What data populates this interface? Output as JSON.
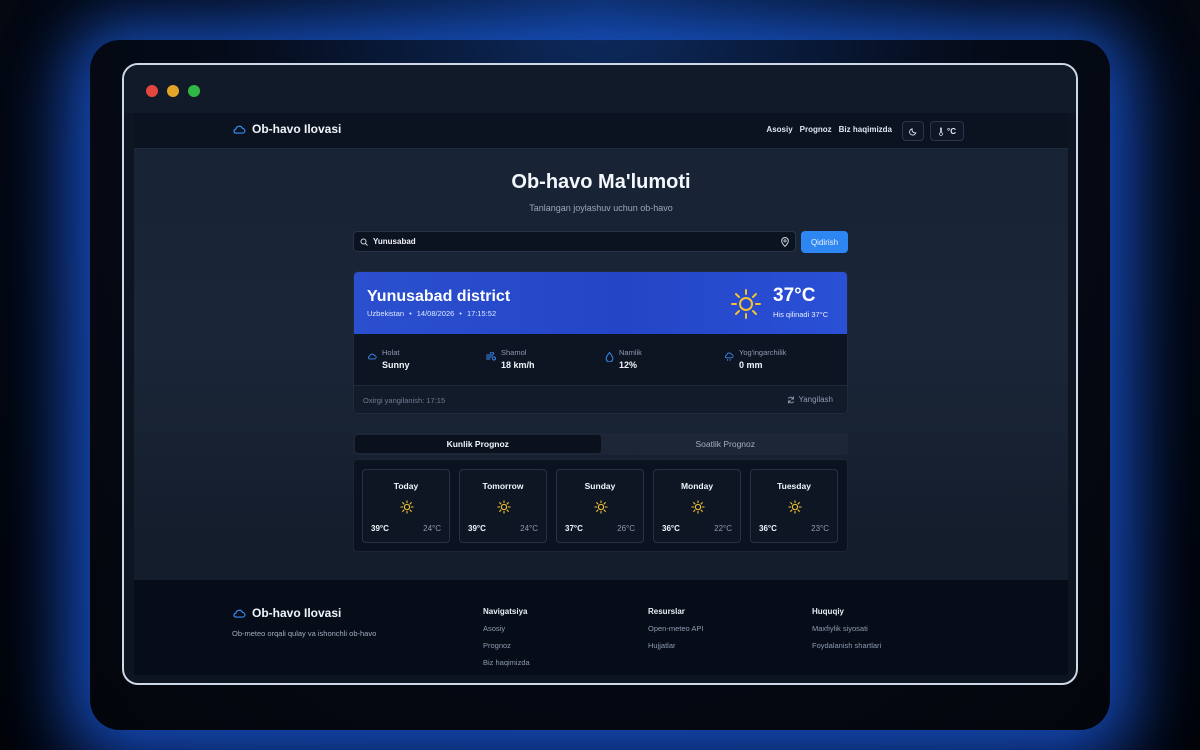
{
  "colors": {
    "accent": "#2e86f2",
    "header_gradient_start": "#2a4fcf",
    "sun": "#f2c230",
    "background": "#172235"
  },
  "navbar": {
    "brand": "Ob-havo Ilovasi",
    "links": [
      "Asosiy",
      "Prognoz",
      "Biz haqimizda"
    ],
    "theme_icon": "moon-icon",
    "unit_label": "°C"
  },
  "hero": {
    "title": "Ob-havo Ma'lumoti",
    "subtitle": "Tanlangan joylashuv uchun ob-havo"
  },
  "search": {
    "value": "Yunusabad",
    "button": "Qidirish"
  },
  "current": {
    "location": "Yunusabad district",
    "country": "Uzbekistan",
    "date": "14/08/2026",
    "time": "17:15:52",
    "temperature": "37°C",
    "feels_like": "His qilinadi 37°C",
    "stats": [
      {
        "label": "Holat",
        "value": "Sunny",
        "icon": "cloud-icon"
      },
      {
        "label": "Shamol",
        "value": "18 km/h",
        "icon": "wind-icon"
      },
      {
        "label": "Namlik",
        "value": "12%",
        "icon": "humidity-icon"
      },
      {
        "label": "Yog'ingarchilik",
        "value": "0 mm",
        "icon": "rain-icon"
      }
    ],
    "updated": "Oxirgi yangilanish: 17:15",
    "refresh": "Yangilash"
  },
  "tabs": [
    "Kunlik Prognoz",
    "Soatlik Prognoz"
  ],
  "forecast": [
    {
      "day": "Today",
      "max": "39°C",
      "min": "24°C"
    },
    {
      "day": "Tomorrow",
      "max": "39°C",
      "min": "24°C"
    },
    {
      "day": "Sunday",
      "max": "37°C",
      "min": "26°C"
    },
    {
      "day": "Monday",
      "max": "36°C",
      "min": "22°C"
    },
    {
      "day": "Tuesday",
      "max": "36°C",
      "min": "23°C"
    }
  ],
  "footer": {
    "brand": "Ob-havo Ilovasi",
    "tagline": "Ob-meteo orqali qulay va ishonchli ob-havo",
    "columns": [
      {
        "title": "Navigatsiya",
        "links": [
          "Asosiy",
          "Prognoz",
          "Biz haqimizda"
        ]
      },
      {
        "title": "Resurslar",
        "links": [
          "Open-meteo API",
          "Hujjatlar"
        ]
      },
      {
        "title": "Huquqiy",
        "links": [
          "Maxfiylik siyosati",
          "Foydalanish shartlari"
        ]
      }
    ]
  }
}
